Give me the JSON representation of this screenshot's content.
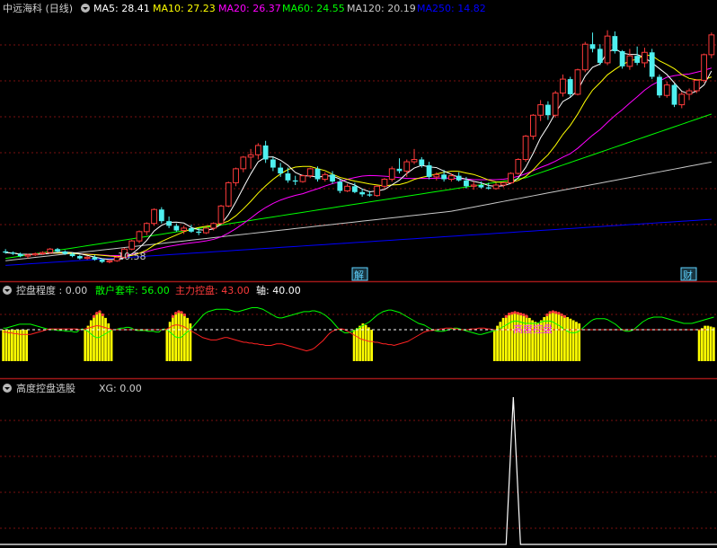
{
  "colors": {
    "background": "#000000",
    "grid_dash": "#7a1010",
    "separator": "#a01818",
    "text": "#d0d0d0",
    "candle_up": "#ff3b3b",
    "candle_down": "#4ff0f0",
    "ma5": "#ffffff",
    "ma10": "#ffff00",
    "ma20": "#ff00ff",
    "ma60": "#00ff00",
    "ma120": "#c8c8c8",
    "ma250": "#0000ff",
    "bars": "#ffff00",
    "retail_line": "#00ff00",
    "main_line": "#ff2222",
    "axis_dashed": "#ffffff",
    "xg_line": "#ffffff",
    "marker_box": "#5fd2ff"
  },
  "main_panel": {
    "title": "中远海科 (日线)",
    "indicators": [
      {
        "label": "MA5: 28.41",
        "color": "#ffffff"
      },
      {
        "label": "MA10: 27.23",
        "color": "#ffff00"
      },
      {
        "label": "MA20: 26.37",
        "color": "#ff00ff"
      },
      {
        "label": "MA60: 24.55",
        "color": "#00ff00"
      },
      {
        "label": "MA120: 20.19",
        "color": "#c8c8c8"
      },
      {
        "label": "MA250: 14.82",
        "color": "#0000ff"
      }
    ],
    "low_price_label": "10.58",
    "markers": [
      "解",
      "财"
    ]
  },
  "panel2": {
    "title": "控盘程度 : 0.00",
    "items": [
      {
        "label": "散户套牢: 56.00",
        "color": "#00ff00"
      },
      {
        "label": "主力控盘: 43.00",
        "color": "#ff3b3b"
      },
      {
        "label": "轴: 40.00",
        "color": "#ffffff"
      }
    ],
    "annotation": "高度控盘"
  },
  "panel3": {
    "title": "高度控盘选股",
    "items": [
      {
        "label": "XG: 0.00",
        "color": "#d0d0d0"
      }
    ]
  },
  "chart_data": [
    {
      "type": "candlestick",
      "candles": [
        [
          11.6,
          11.8,
          11.4,
          11.5
        ],
        [
          11.5,
          11.6,
          11.3,
          11.4
        ],
        [
          11.4,
          11.5,
          11.1,
          11.2
        ],
        [
          11.2,
          11.4,
          11.0,
          11.3
        ],
        [
          11.3,
          11.5,
          11.2,
          11.4
        ],
        [
          11.4,
          11.6,
          11.3,
          11.5
        ],
        [
          11.5,
          11.9,
          11.4,
          11.8
        ],
        [
          11.8,
          11.9,
          11.5,
          11.6
        ],
        [
          11.6,
          11.7,
          11.3,
          11.4
        ],
        [
          11.4,
          11.5,
          11.1,
          11.2
        ],
        [
          11.2,
          11.3,
          10.9,
          11.0
        ],
        [
          11.0,
          11.2,
          10.9,
          11.1
        ],
        [
          11.1,
          11.3,
          10.8,
          10.9
        ],
        [
          10.9,
          11.0,
          10.6,
          10.7
        ],
        [
          10.7,
          10.9,
          10.58,
          10.8
        ],
        [
          10.8,
          11.2,
          10.7,
          11.1
        ],
        [
          11.1,
          11.9,
          11.0,
          11.8
        ],
        [
          11.8,
          12.6,
          11.7,
          12.5
        ],
        [
          12.5,
          13.4,
          12.3,
          13.3
        ],
        [
          13.3,
          14.1,
          13.0,
          14.0
        ],
        [
          14.0,
          15.3,
          13.8,
          15.2
        ],
        [
          15.2,
          15.4,
          14.0,
          14.2
        ],
        [
          14.2,
          14.6,
          13.6,
          13.8
        ],
        [
          13.8,
          14.0,
          13.3,
          13.4
        ],
        [
          13.4,
          13.8,
          13.1,
          13.6
        ],
        [
          13.6,
          13.9,
          13.2,
          13.3
        ],
        [
          13.3,
          13.6,
          13.0,
          13.2
        ],
        [
          13.2,
          13.7,
          13.1,
          13.6
        ],
        [
          13.6,
          14.1,
          13.4,
          14.0
        ],
        [
          14.0,
          15.6,
          13.9,
          15.5
        ],
        [
          15.5,
          17.6,
          15.4,
          17.5
        ],
        [
          17.5,
          18.8,
          17.2,
          18.7
        ],
        [
          18.7,
          19.8,
          18.4,
          19.7
        ],
        [
          19.7,
          20.4,
          18.7,
          19.9
        ],
        [
          19.9,
          20.9,
          19.5,
          20.7
        ],
        [
          20.7,
          21.1,
          19.2,
          19.5
        ],
        [
          19.5,
          19.7,
          18.5,
          18.8
        ],
        [
          18.8,
          19.2,
          18.0,
          18.3
        ],
        [
          18.3,
          18.8,
          17.5,
          17.7
        ],
        [
          17.7,
          18.1,
          17.3,
          17.6
        ],
        [
          17.6,
          18.2,
          17.5,
          18.1
        ],
        [
          18.1,
          18.8,
          17.9,
          18.7
        ],
        [
          18.7,
          18.9,
          17.6,
          17.8
        ],
        [
          17.8,
          18.4,
          17.6,
          18.2
        ],
        [
          18.2,
          18.5,
          17.4,
          17.6
        ],
        [
          17.6,
          17.8,
          16.6,
          16.8
        ],
        [
          16.8,
          17.4,
          16.7,
          17.2
        ],
        [
          17.2,
          17.5,
          16.6,
          16.7
        ],
        [
          16.7,
          17.0,
          16.3,
          16.5
        ],
        [
          16.5,
          16.8,
          16.3,
          16.4
        ],
        [
          16.4,
          17.3,
          16.3,
          17.2
        ],
        [
          17.2,
          17.9,
          17.0,
          17.8
        ],
        [
          17.8,
          18.9,
          17.6,
          18.7
        ],
        [
          18.7,
          19.6,
          18.3,
          18.5
        ],
        [
          18.5,
          19.5,
          18.0,
          19.3
        ],
        [
          19.3,
          20.4,
          19.1,
          19.5
        ],
        [
          19.5,
          19.7,
          18.8,
          19.0
        ],
        [
          19.0,
          19.3,
          17.8,
          18.0
        ],
        [
          18.0,
          18.4,
          17.7,
          18.2
        ],
        [
          18.2,
          18.6,
          17.6,
          17.8
        ],
        [
          17.8,
          18.3,
          17.6,
          18.1
        ],
        [
          18.1,
          18.4,
          17.6,
          17.7
        ],
        [
          17.7,
          18.0,
          17.0,
          17.2
        ],
        [
          17.2,
          17.6,
          16.9,
          17.3
        ],
        [
          17.3,
          17.6,
          17.0,
          17.1
        ],
        [
          17.1,
          17.5,
          16.9,
          17.0
        ],
        [
          17.0,
          17.5,
          16.9,
          17.3
        ],
        [
          17.3,
          17.6,
          17.1,
          17.5
        ],
        [
          17.5,
          18.4,
          17.4,
          18.3
        ],
        [
          18.3,
          19.6,
          18.2,
          19.5
        ],
        [
          19.5,
          21.6,
          19.3,
          21.5
        ],
        [
          21.5,
          23.4,
          21.2,
          23.3
        ],
        [
          23.3,
          24.6,
          22.8,
          24.2
        ],
        [
          24.2,
          24.5,
          22.9,
          23.3
        ],
        [
          23.3,
          25.4,
          23.1,
          25.2
        ],
        [
          25.2,
          26.8,
          24.9,
          26.4
        ],
        [
          26.4,
          26.6,
          24.9,
          25.1
        ],
        [
          25.1,
          27.3,
          25.0,
          27.2
        ],
        [
          27.2,
          29.6,
          27.0,
          29.4
        ],
        [
          29.4,
          30.4,
          28.7,
          29.0
        ],
        [
          29.0,
          29.4,
          27.6,
          27.8
        ],
        [
          27.8,
          30.6,
          27.6,
          30.1
        ],
        [
          30.1,
          30.5,
          28.6,
          28.8
        ],
        [
          28.8,
          28.9,
          27.3,
          27.5
        ],
        [
          27.5,
          29.0,
          27.2,
          28.4
        ],
        [
          28.4,
          29.2,
          27.6,
          27.8
        ],
        [
          27.8,
          29.1,
          27.4,
          28.7
        ],
        [
          28.7,
          29.0,
          26.4,
          26.6
        ],
        [
          26.6,
          26.8,
          24.8,
          25.0
        ],
        [
          25.0,
          26.2,
          24.8,
          25.9
        ],
        [
          25.9,
          26.0,
          24.0,
          24.2
        ],
        [
          24.2,
          25.3,
          23.9,
          25.1
        ],
        [
          25.1,
          25.6,
          24.6,
          25.4
        ],
        [
          25.4,
          26.4,
          25.2,
          26.3
        ],
        [
          26.3,
          28.6,
          26.1,
          28.5
        ],
        [
          28.5,
          30.4,
          28.2,
          30.2
        ]
      ],
      "ylim": [
        10.2,
        31.5
      ]
    },
    {
      "type": "bar",
      "values": [
        40,
        40,
        40,
        40,
        40,
        40,
        40,
        40,
        40,
        0,
        0,
        0,
        0,
        0,
        0,
        0,
        0,
        0,
        0,
        0,
        0,
        0,
        0,
        0,
        0,
        0,
        0,
        0,
        40,
        45,
        52,
        58,
        62,
        64,
        60,
        55,
        48,
        40,
        0,
        0,
        0,
        0,
        0,
        0,
        0,
        0,
        0,
        0,
        0,
        0,
        0,
        0,
        0,
        0,
        0,
        0,
        40,
        50,
        58,
        62,
        64,
        63,
        60,
        55,
        48,
        0,
        0,
        0,
        0,
        0,
        0,
        0,
        0,
        0,
        0,
        0,
        0,
        0,
        0,
        0,
        0,
        0,
        0,
        0,
        0,
        0,
        0,
        0,
        0,
        0,
        0,
        0,
        0,
        0,
        0,
        0,
        0,
        0,
        0,
        0,
        0,
        0,
        0,
        0,
        0,
        0,
        0,
        0,
        0,
        0,
        0,
        0,
        0,
        0,
        0,
        0,
        0,
        0,
        0,
        0,
        40,
        42,
        45,
        48,
        46,
        43,
        40,
        0,
        0,
        0,
        0,
        0,
        0,
        0,
        0,
        0,
        0,
        0,
        0,
        0,
        0,
        0,
        0,
        0,
        0,
        0,
        0,
        0,
        0,
        0,
        0,
        0,
        0,
        0,
        0,
        0,
        0,
        0,
        0,
        0,
        0,
        0,
        0,
        0,
        0,
        0,
        0,
        0,
        40,
        45,
        50,
        55,
        58,
        61,
        62,
        63,
        62,
        61,
        60,
        58,
        55,
        52,
        50,
        48,
        52,
        56,
        60,
        63,
        64,
        63,
        62,
        60,
        58,
        56,
        54,
        52,
        50,
        48,
        0,
        0,
        0,
        0,
        0,
        0,
        0,
        0,
        0,
        0,
        0,
        0,
        0,
        0,
        0,
        0,
        0,
        0,
        0,
        0,
        0,
        0,
        0,
        0,
        0,
        0,
        0,
        0,
        0,
        0,
        0,
        0,
        0,
        0,
        0,
        0,
        0,
        0,
        0,
        0,
        40,
        42,
        45,
        45,
        44,
        43
      ],
      "retail_line": [
        42,
        42,
        43,
        44,
        45,
        46,
        47,
        47,
        47,
        47,
        47,
        46,
        45,
        44,
        43,
        42,
        41,
        40,
        40,
        40,
        39,
        39,
        39,
        38,
        38,
        38,
        37,
        37,
        40,
        41,
        40,
        38,
        35,
        32,
        30,
        30,
        32,
        34,
        36,
        38,
        40,
        40,
        41,
        42,
        42,
        43,
        43,
        42,
        40,
        39,
        39,
        39,
        39,
        38,
        38,
        38,
        37,
        37,
        40,
        41,
        40,
        37,
        34,
        31,
        30,
        30,
        33,
        36,
        39,
        42,
        46,
        50,
        54,
        58,
        61,
        63,
        64,
        65,
        66,
        66,
        66,
        66,
        66,
        65,
        64,
        63,
        63,
        64,
        65,
        66,
        67,
        68,
        68,
        68,
        67,
        66,
        64,
        62,
        60,
        58,
        56,
        55,
        55,
        56,
        57,
        58,
        59,
        60,
        61,
        62,
        63,
        63,
        63,
        64,
        64,
        63,
        62,
        60,
        58,
        55,
        52,
        48,
        44,
        40,
        38,
        36,
        36,
        37,
        38,
        40,
        42,
        44,
        46,
        48,
        50,
        53,
        56,
        59,
        61,
        63,
        64,
        65,
        65,
        64,
        63,
        62,
        60,
        58,
        56,
        54,
        52,
        50,
        48,
        47,
        46,
        44,
        42,
        40,
        39,
        38,
        38,
        38,
        39,
        40,
        41,
        42,
        42,
        41,
        40,
        39,
        38,
        37,
        36,
        35,
        34,
        34,
        35,
        36,
        37,
        38,
        39,
        40,
        42,
        44,
        46,
        48,
        50,
        51,
        51,
        50,
        49,
        48,
        48,
        48,
        48,
        48,
        49,
        50,
        51,
        51,
        51,
        50,
        48,
        46,
        44,
        41,
        39,
        37,
        36,
        36,
        37,
        39,
        42,
        45,
        48,
        51,
        53,
        54,
        54,
        54,
        54,
        53,
        51,
        49,
        47,
        44,
        41,
        39,
        38,
        38,
        39,
        41,
        44,
        47,
        50,
        52,
        54,
        55,
        56,
        56,
        56,
        56,
        55,
        54,
        53,
        52,
        51,
        50,
        49,
        48,
        48,
        48,
        48,
        49,
        50,
        51,
        52,
        53,
        54,
        55,
        56
      ],
      "main_line": [
        37,
        37,
        36,
        36,
        35,
        35,
        34,
        34,
        34,
        34,
        34,
        35,
        36,
        37,
        38,
        39,
        40,
        41,
        41,
        41,
        41,
        41,
        41,
        41,
        41,
        41,
        41,
        41,
        40,
        40,
        41,
        42,
        43,
        44,
        45,
        45,
        44,
        43,
        42,
        41,
        40,
        40,
        40,
        40,
        40,
        40,
        40,
        40,
        40,
        40,
        40,
        40,
        40,
        40,
        40,
        40,
        40,
        40,
        40,
        40,
        41,
        43,
        45,
        46,
        46,
        45,
        44,
        42,
        40,
        38,
        36,
        34,
        32,
        30,
        29,
        28,
        27,
        27,
        27,
        28,
        29,
        30,
        30,
        29,
        28,
        27,
        26,
        25,
        24,
        24,
        23,
        23,
        22,
        22,
        21,
        21,
        20,
        20,
        20,
        21,
        22,
        22,
        22,
        21,
        20,
        19,
        18,
        17,
        16,
        15,
        14,
        13,
        14,
        15,
        17,
        20,
        23,
        26,
        30,
        34,
        37,
        39,
        40,
        41,
        41,
        40,
        38,
        36,
        34,
        32,
        30,
        28,
        27,
        26,
        25,
        25,
        24,
        24,
        23,
        22,
        22,
        21,
        21,
        20,
        21,
        22,
        23,
        24,
        25,
        27,
        29,
        31,
        33,
        35,
        37,
        38,
        39,
        39,
        40,
        40,
        41,
        41,
        42,
        42,
        42,
        41,
        41,
        40,
        40,
        40,
        40,
        41,
        41,
        41,
        42,
        42,
        42,
        41,
        41,
        40,
        40,
        40,
        40,
        40,
        40,
        40,
        40,
        40,
        40,
        40,
        40,
        40,
        40,
        40,
        40,
        40,
        40,
        40,
        40,
        40,
        40,
        40,
        40,
        40,
        40,
        40,
        40,
        40,
        40,
        40,
        40,
        40,
        40,
        40,
        40,
        40,
        40,
        40,
        40,
        40,
        40,
        40,
        40,
        40,
        40,
        40,
        40,
        40,
        40,
        40,
        40,
        40,
        40,
        40,
        40,
        40,
        40,
        40,
        40,
        40,
        40,
        40,
        40,
        40,
        40,
        40,
        40,
        40,
        40,
        40,
        40,
        40,
        40,
        40,
        40,
        40,
        40,
        40
      ],
      "axis": 40,
      "ylim": [
        0,
        80
      ]
    },
    {
      "type": "line",
      "spike_index": 0.717,
      "values_note_free": [
        0,
        1
      ],
      "ylim": [
        0,
        1
      ]
    }
  ]
}
